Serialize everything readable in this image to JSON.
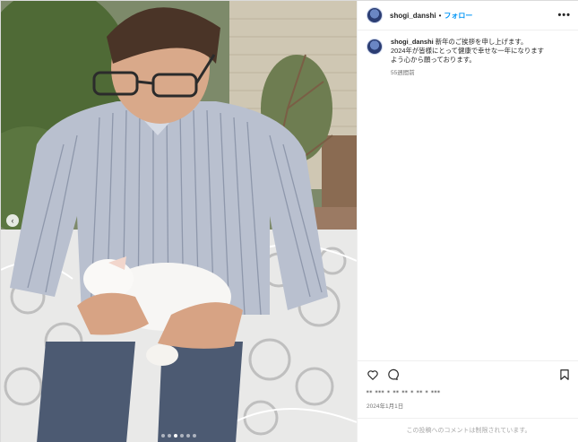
{
  "post": {
    "username": "shogi_danshi",
    "separator": "•",
    "follow_label": "フォロー",
    "more_label": "•••",
    "caption_lines": [
      "新年のご挨拶を申し上げます。",
      "2024年が皆様にとって健康で幸せな一年になります",
      "よう心から願っております。"
    ],
    "time_ago": "55週間前",
    "likes_blurred": "▪▪ ▪▪▪ ▪ ▪▪ ▪▪ ▪ ▪▪ ▪ ▪▪▪",
    "date": "2024年1月1日",
    "comments_disabled": "この投稿へのコメントは制限されています。"
  },
  "carousel": {
    "slides": 6,
    "active": 3,
    "prev_label": "‹"
  },
  "icons": {
    "avatar": "profile-avatar",
    "like": "heart-icon",
    "comment": "comment-icon",
    "save": "bookmark-icon",
    "prev": "chevron-left-icon"
  },
  "colors": {
    "link": "#0095f6",
    "muted": "#737373",
    "border": "#efefef"
  }
}
